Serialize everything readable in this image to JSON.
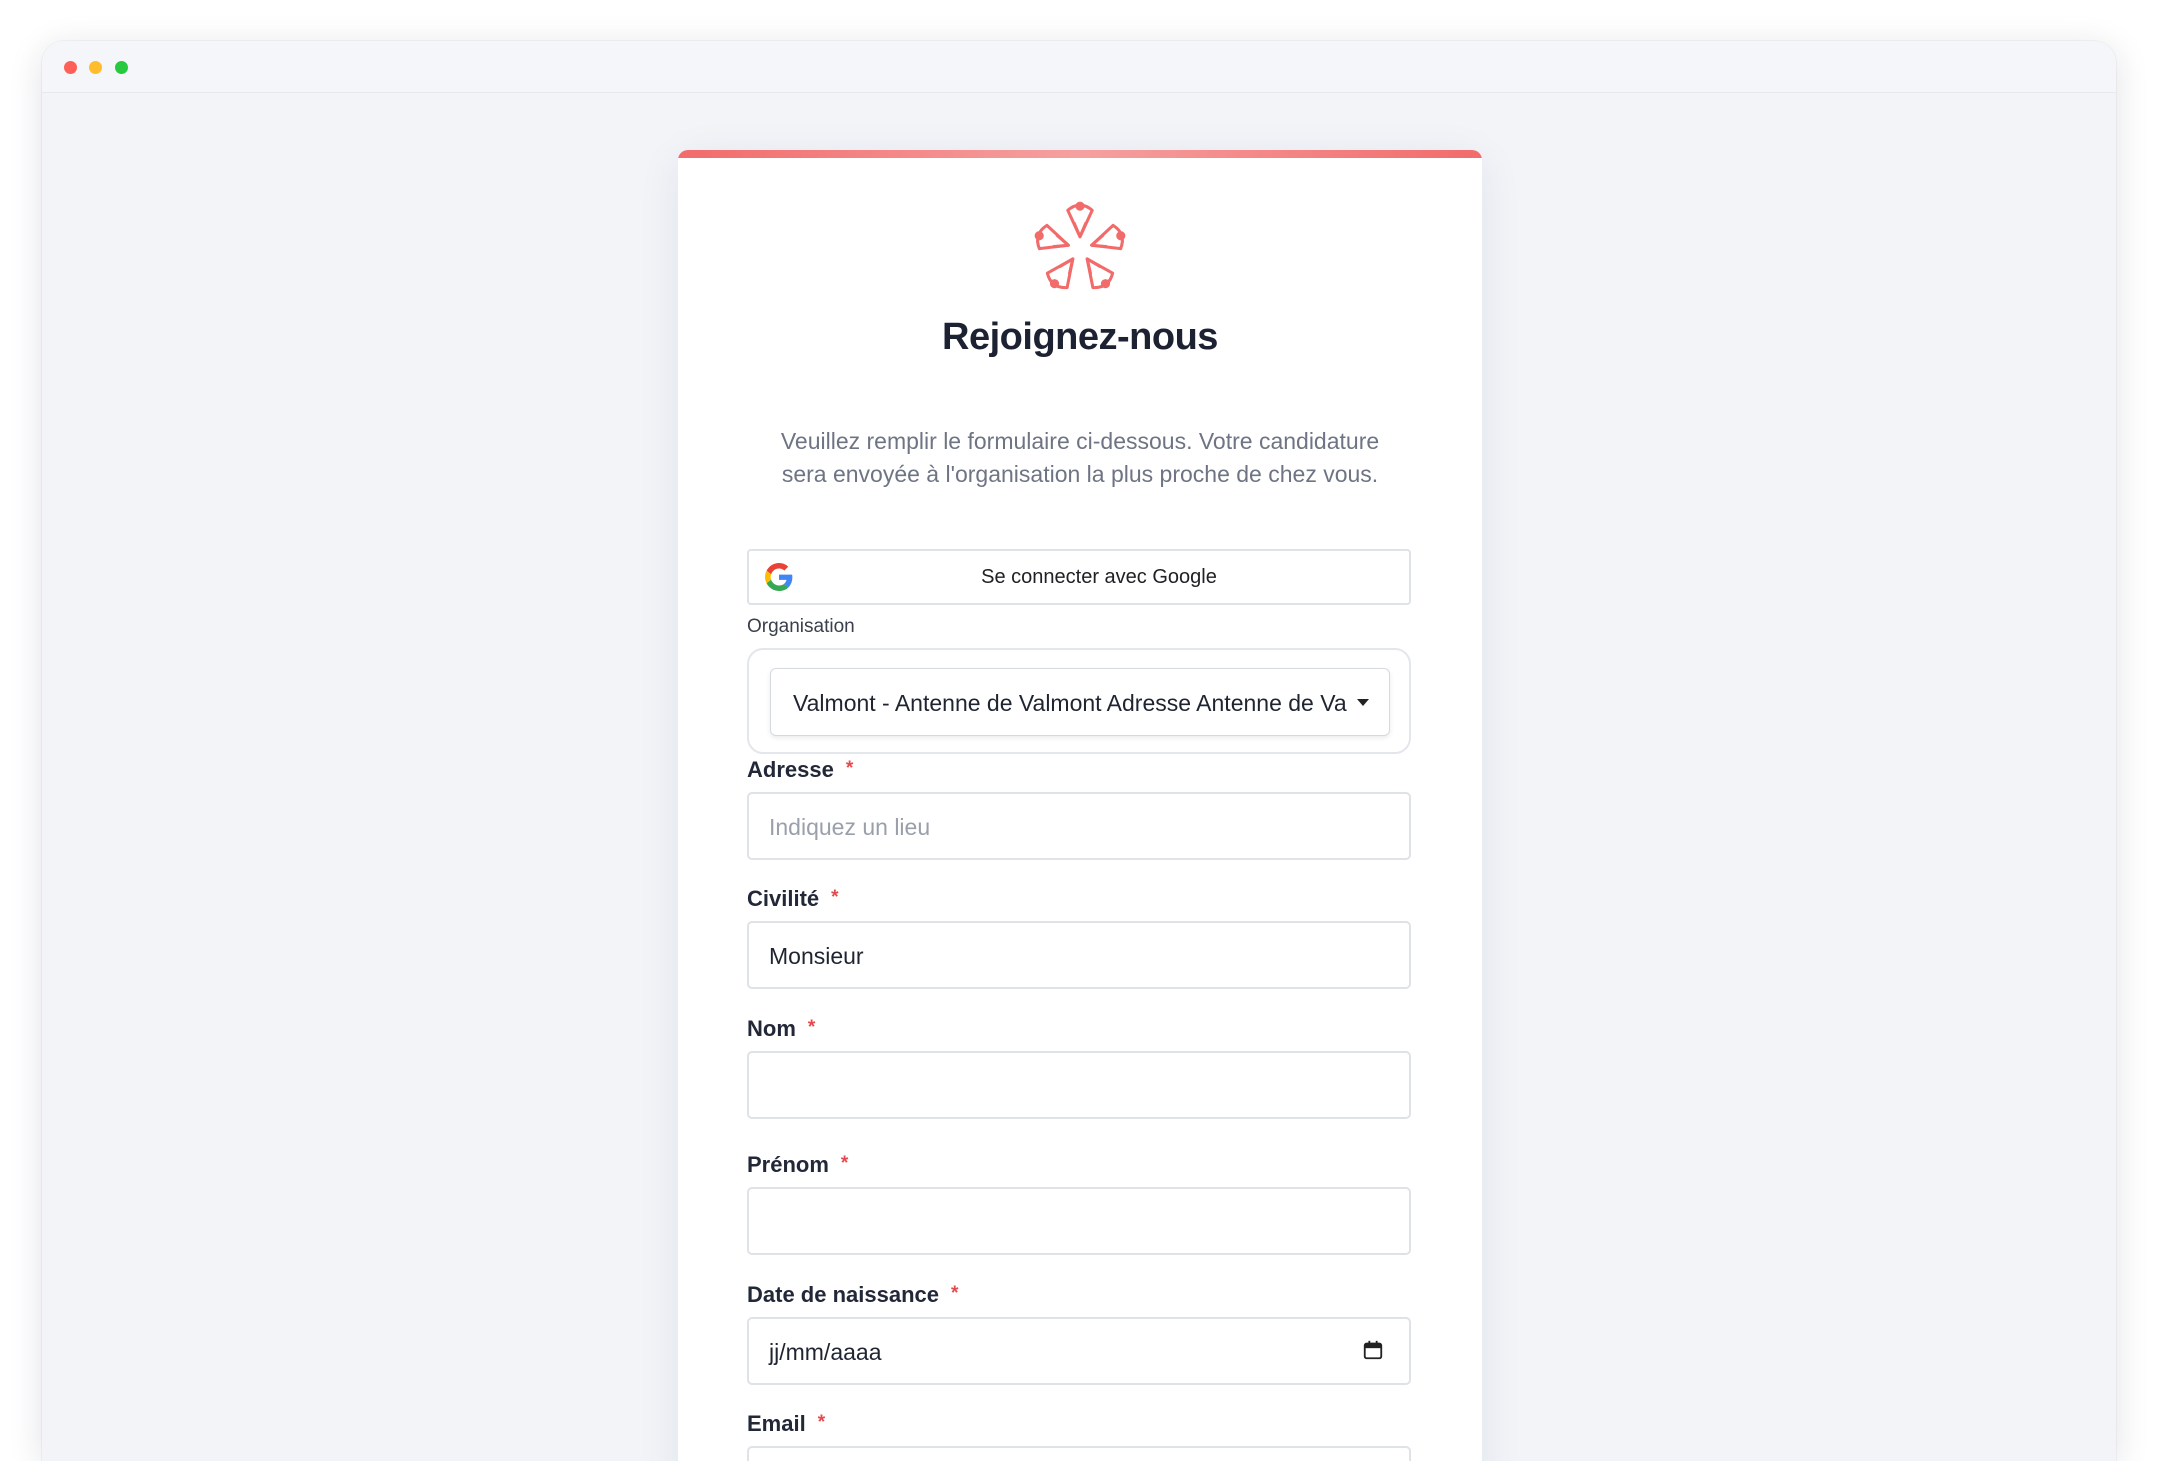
{
  "window": {
    "controls": [
      "close",
      "minimize",
      "maximize"
    ]
  },
  "brand": {
    "accent": "#f26b6b",
    "logo_icon": "flower-logo-icon"
  },
  "form": {
    "title": "Rejoignez-nous",
    "subtitle": "Veuillez remplir le formulaire ci-dessous. Votre candidature sera envoyée à l'organisation la plus proche de chez vous.",
    "google_button": {
      "label": "Se connecter avec Google",
      "icon": "google-icon"
    },
    "organisation": {
      "label": "Organisation",
      "selected": "Valmont - Antenne de Valmont Adresse Antenne de Valmont"
    },
    "fields": {
      "adresse": {
        "label": "Adresse",
        "required_mark": "*",
        "placeholder": "Indiquez un lieu",
        "value": ""
      },
      "civilite": {
        "label": "Civilité",
        "required_mark": "*",
        "value": "Monsieur"
      },
      "nom": {
        "label": "Nom",
        "required_mark": "*",
        "value": ""
      },
      "prenom": {
        "label": "Prénom",
        "required_mark": "*",
        "value": ""
      },
      "date_naissance": {
        "label": "Date de naissance",
        "required_mark": "*",
        "placeholder": "jj/mm/aaaa",
        "icon": "calendar-icon"
      },
      "email": {
        "label": "Email",
        "required_mark": "*",
        "value": ""
      }
    }
  }
}
